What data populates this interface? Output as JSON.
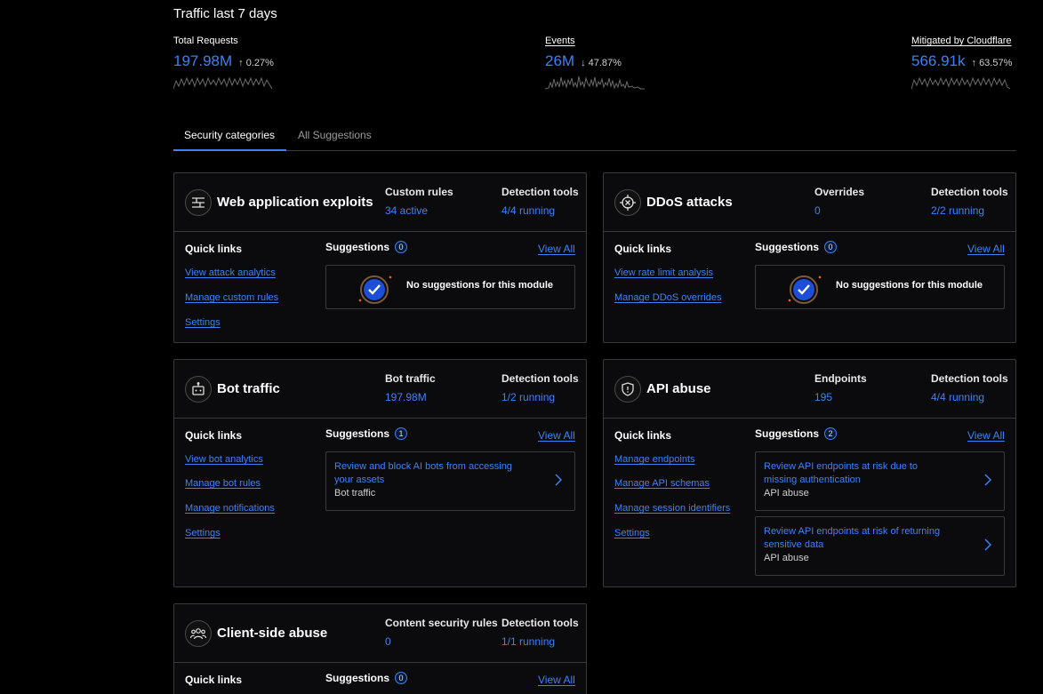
{
  "page": {
    "title": "Traffic last 7 days"
  },
  "metrics": [
    {
      "label": "Total Requests",
      "value": "197.98M",
      "delta": "0.27%",
      "direction": "up"
    },
    {
      "label": "Events",
      "value": "26M",
      "delta": "47.87%",
      "direction": "down"
    },
    {
      "label": "Mitigated by Cloudflare",
      "value": "566.91k",
      "delta": "63.57%",
      "direction": "up"
    }
  ],
  "tabs": [
    {
      "label": "Security categories",
      "active": true
    },
    {
      "label": "All Suggestions",
      "active": false
    }
  ],
  "common": {
    "quick_links": "Quick links",
    "suggestions": "Suggestions",
    "view_all": "View All",
    "no_suggestions": "No suggestions for this module"
  },
  "cards": {
    "web": {
      "title": "Web application exploits",
      "icon": "firewall-icon",
      "stat1_label": "Custom rules",
      "stat1_value": "34 active",
      "stat2_label": "Detection tools",
      "stat2_value": "4/4 running",
      "suggestion_count": "0",
      "links": [
        "View attack analytics",
        "Manage custom rules",
        "Settings"
      ]
    },
    "ddos": {
      "title": "DDoS attacks",
      "icon": "target-icon",
      "stat1_label": "Overrides",
      "stat1_value": "0",
      "stat2_label": "Detection tools",
      "stat2_value": "2/2 running",
      "suggestion_count": "0",
      "links": [
        "View rate limit analysis",
        "Manage DDoS overrides"
      ]
    },
    "bot": {
      "title": "Bot traffic",
      "icon": "robot-icon",
      "stat1_label": "Bot traffic",
      "stat1_value": "197.98M",
      "stat2_label": "Detection tools",
      "stat2_value": "1/2 running",
      "suggestion_count": "1",
      "links": [
        "View bot analytics",
        "Manage bot rules",
        "Manage notifications",
        "Settings"
      ],
      "suggestions": [
        {
          "text": "Review and block AI bots from accessing your assets",
          "category": "Bot traffic"
        }
      ]
    },
    "api": {
      "title": "API abuse",
      "icon": "shield-icon",
      "stat1_label": "Endpoints",
      "stat1_value": "195",
      "stat2_label": "Detection tools",
      "stat2_value": "4/4 running",
      "suggestion_count": "2",
      "links": [
        "Manage endpoints",
        "Manage API schemas",
        "Manage session identifiers",
        "Settings"
      ],
      "suggestions": [
        {
          "text": "Review API endpoints at risk due to missing authentication",
          "category": "API abuse"
        },
        {
          "text": "Review API endpoints at risk of returning sensitive data",
          "category": "API abuse"
        }
      ]
    },
    "client": {
      "title": "Client-side abuse",
      "icon": "users-icon",
      "stat1_label": "Content security rules",
      "stat1_value": "0",
      "stat2_label": "Detection tools",
      "stat2_value": "1/1 running",
      "suggestion_count": "0",
      "links": []
    }
  },
  "colors": {
    "accent": "#3b82f6",
    "background": "#000000",
    "card": "#0b0b0d",
    "border": "#3a3a3a"
  }
}
